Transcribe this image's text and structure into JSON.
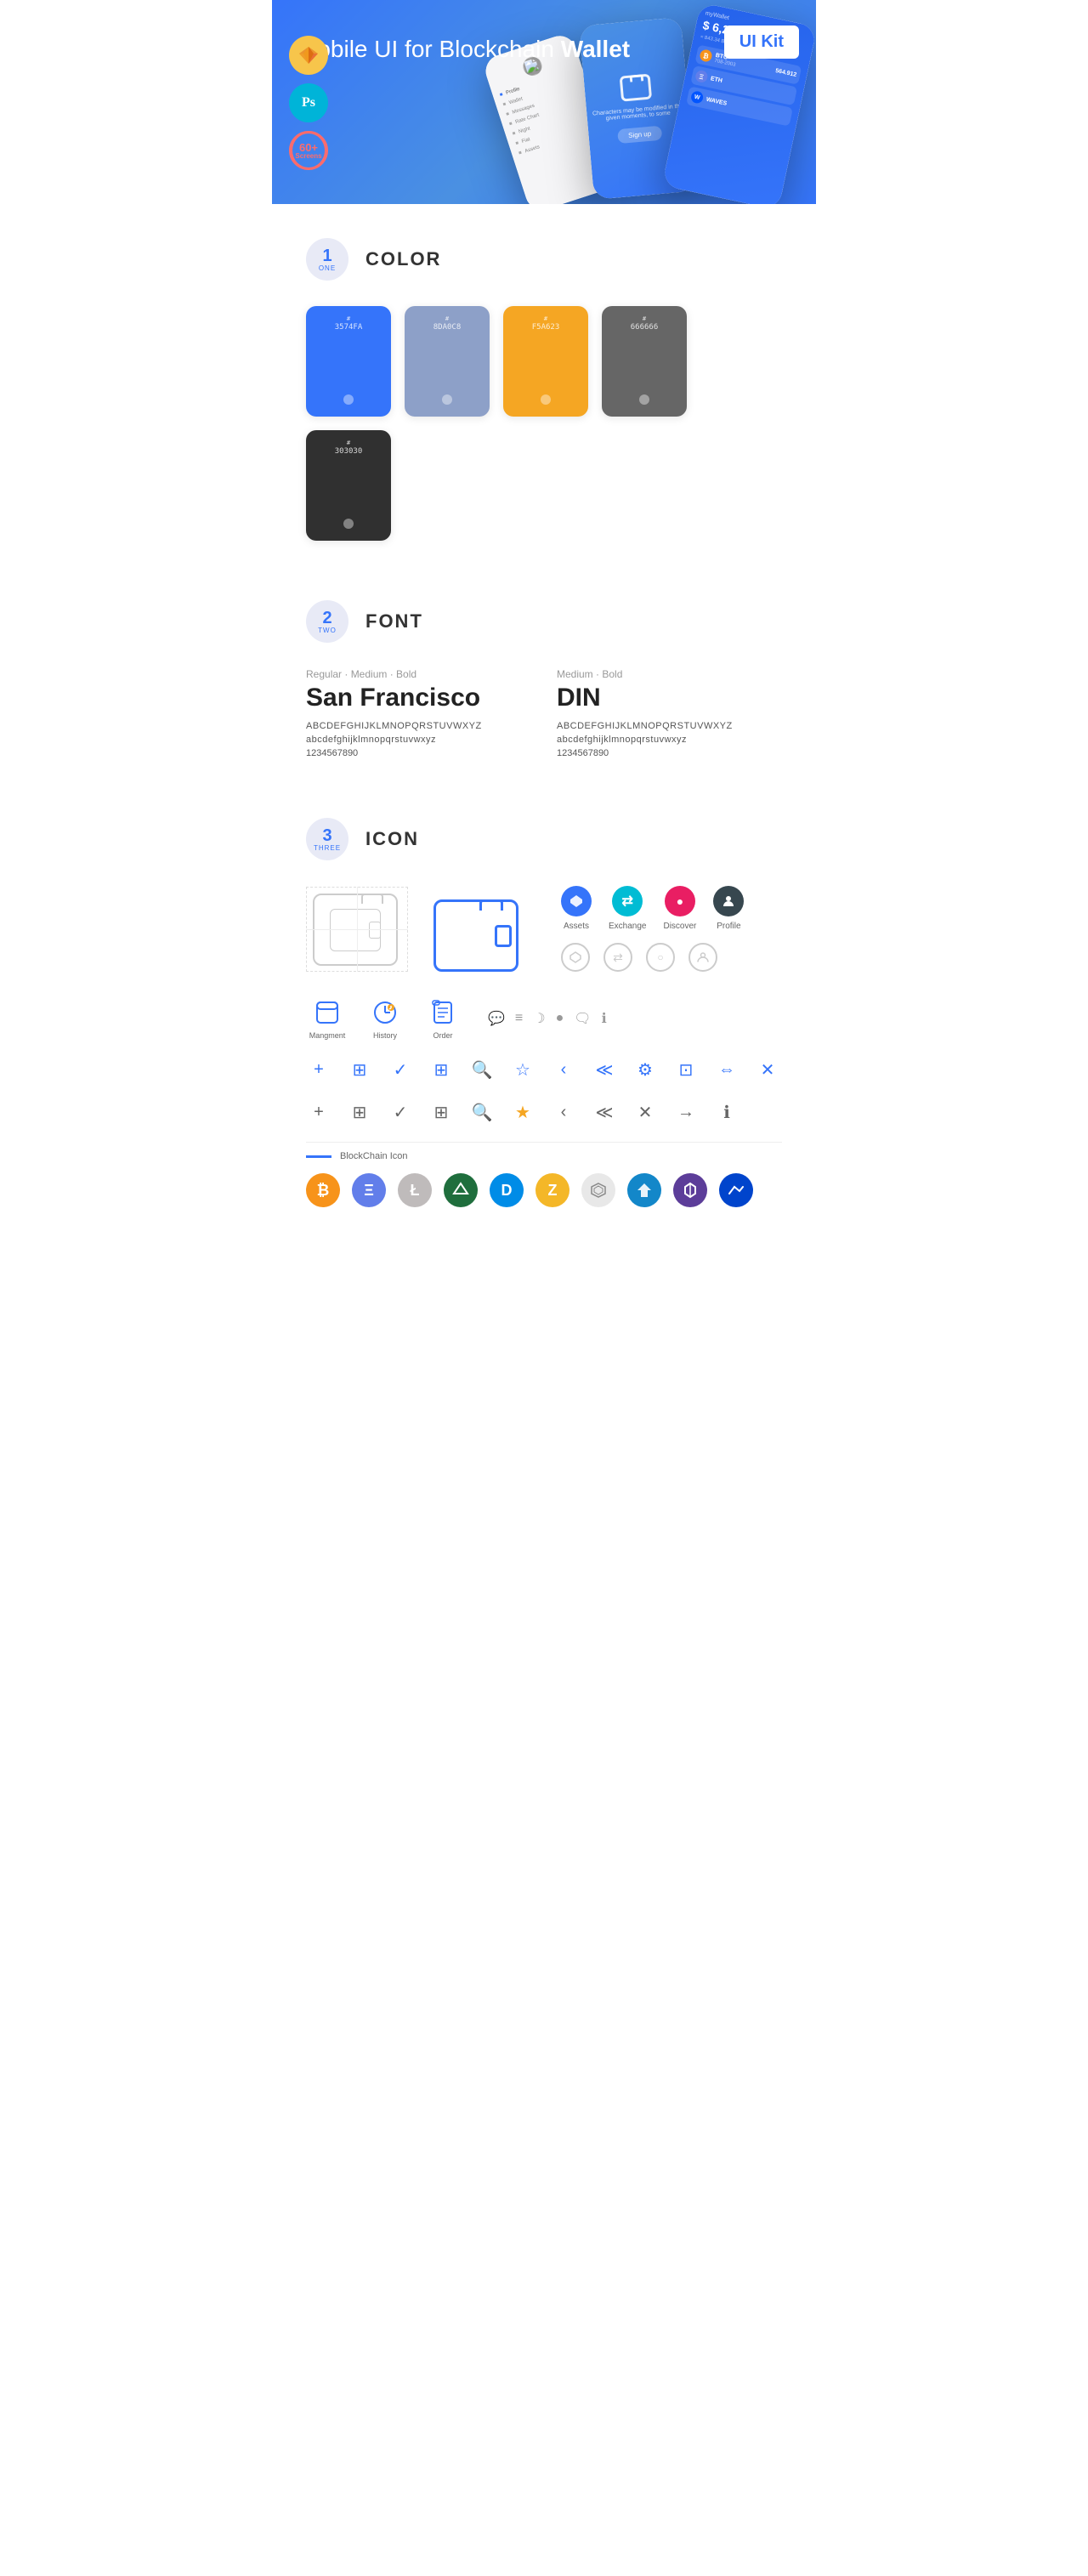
{
  "hero": {
    "title_normal": "Mobile UI for Blockchain ",
    "title_bold": "Wallet",
    "badge": "UI Kit",
    "badges": [
      {
        "id": "sketch",
        "label": "Sketch"
      },
      {
        "id": "photoshop",
        "label": "Ps"
      },
      {
        "id": "screens",
        "line1": "60+",
        "line2": "Screens"
      }
    ]
  },
  "sections": {
    "color": {
      "number": "1",
      "word": "ONE",
      "title": "COLOR",
      "swatches": [
        {
          "hex": "#3574FA",
          "label": "3574FA",
          "bg": "#3574FA"
        },
        {
          "hex": "#8DA0C8",
          "label": "8DA0C8",
          "bg": "#8DA0C8"
        },
        {
          "hex": "#F5A623",
          "label": "F5A623",
          "bg": "#F5A623"
        },
        {
          "hex": "#666666",
          "label": "666666",
          "bg": "#666666"
        },
        {
          "hex": "#303030",
          "label": "303030",
          "bg": "#303030"
        }
      ]
    },
    "font": {
      "number": "2",
      "word": "TWO",
      "title": "FONT",
      "fonts": [
        {
          "style": "Regular · Medium · Bold",
          "name": "San Francisco",
          "upper": "ABCDEFGHIJKLMNOPQRSTUVWXYZ",
          "lower": "abcdefghijklmnopqrstuvwxyz",
          "nums": "1234567890"
        },
        {
          "style": "Medium · Bold",
          "name": "DIN",
          "upper": "ABCDEFGHIJKLMNOPQRSTUVWXYZ",
          "lower": "abcdefghijklmnopqrstuvwxyz",
          "nums": "1234567890"
        }
      ]
    },
    "icon": {
      "number": "3",
      "word": "THREE",
      "title": "ICON",
      "nav_icons": [
        {
          "label": "Assets",
          "color": "blue",
          "symbol": "◆"
        },
        {
          "label": "Exchange",
          "color": "teal",
          "symbol": "⇄"
        },
        {
          "label": "Discover",
          "color": "pink",
          "symbol": "●"
        },
        {
          "label": "Profile",
          "color": "dark",
          "symbol": "👤"
        }
      ],
      "app_icons": [
        {
          "label": "Mangment",
          "symbol": "▣"
        },
        {
          "label": "History",
          "symbol": "⏱"
        },
        {
          "label": "Order",
          "symbol": "📋"
        }
      ],
      "misc_icons": [
        "+",
        "⊞",
        "✓",
        "⊞",
        "🔍",
        "☆",
        "<",
        "≪",
        "⚙",
        "⊡",
        "⇔",
        "✕"
      ],
      "blockchain_label": "BlockChain Icon",
      "crypto_icons": [
        {
          "symbol": "₿",
          "color": "#F7931A",
          "bg": "#F7931A",
          "label": "BTC"
        },
        {
          "symbol": "Ξ",
          "color": "#627EEA",
          "bg": "#627EEA",
          "label": "ETH"
        },
        {
          "symbol": "Ł",
          "color": "#BFBBBB",
          "bg": "#ccc",
          "label": "LTC"
        },
        {
          "symbol": "N",
          "color": "#58BF00",
          "bg": "#58BF00",
          "label": "NEO"
        },
        {
          "symbol": "D",
          "color": "#008CE7",
          "bg": "#008CE7",
          "label": "DASH"
        },
        {
          "symbol": "Z",
          "color": "#F4B728",
          "bg": "#F4B728",
          "label": "ZEC"
        },
        {
          "symbol": "⬡",
          "color": "#e0e0e0",
          "bg": "#e0e0e0",
          "label": "GRID"
        },
        {
          "symbol": "▲",
          "color": "#1387C9",
          "bg": "#1387C9",
          "label": "STRAT"
        },
        {
          "symbol": "◈",
          "color": "#5C3D99",
          "bg": "#5C3D99",
          "label": "POLY"
        },
        {
          "symbol": "W",
          "color": "#0155FF",
          "bg": "#0155FF",
          "label": "WAVES"
        }
      ]
    }
  }
}
